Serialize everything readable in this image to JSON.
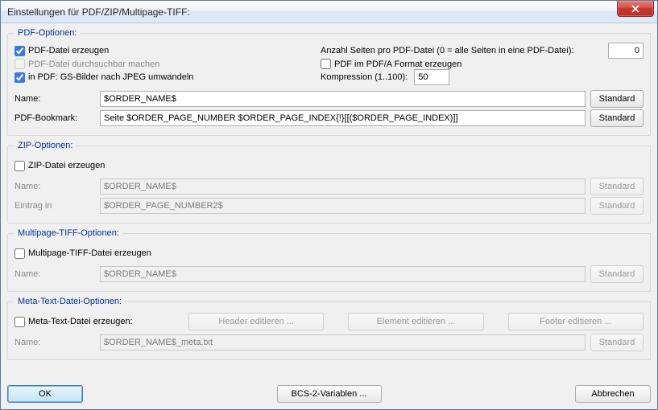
{
  "window": {
    "title": "Einstellungen für PDF/ZIP/Multipage-TIFF:"
  },
  "pdf": {
    "legend": "PDF-Optionen:",
    "create_label": "PDF-Datei erzeugen",
    "create_checked": true,
    "searchable_label": "PDF-Datei durchsuchbar machen",
    "searchable_checked": false,
    "jpeg_label": "in PDF: GS-Bilder nach JPEG umwandeln",
    "jpeg_checked": true,
    "pages_label": "Anzahl Seiten pro PDF-Datei (0 = alle Seiten in eine PDF-Datei):",
    "pages_value": "0",
    "pdfa_label": "PDF im PDF/A Format erzeugen",
    "pdfa_checked": false,
    "compression_label": "Kompression (1..100):",
    "compression_value": "50",
    "name_label": "Name:",
    "name_value": "$ORDER_NAME$",
    "bookmark_label": "PDF-Bookmark:",
    "bookmark_value": "Seite $ORDER_PAGE_NUMBER $ORDER_PAGE_INDEX{!}[[($ORDER_PAGE_INDEX)]]",
    "standard_label": "Standard"
  },
  "zip": {
    "legend": "ZIP-Optionen:",
    "create_label": "ZIP-Datei erzeugen",
    "create_checked": false,
    "name_label": "Name:",
    "name_value": "$ORDER_NAME$",
    "entry_label": "Eintrag in",
    "entry_value": "$ORDER_PAGE_NUMBER2$",
    "standard_label": "Standard"
  },
  "tiff": {
    "legend": "Multipage-TIFF-Optionen:",
    "create_label": "Multipage-TIFF-Datei erzeugen",
    "create_checked": false,
    "name_label": "Name:",
    "name_value": "$ORDER_NAME$",
    "standard_label": "Standard"
  },
  "meta": {
    "legend": "Meta-Text-Datei-Optionen:",
    "create_label": "Meta-Text-Datei erzeugen:",
    "create_checked": false,
    "header_btn": "Header editieren ...",
    "element_btn": "Element editieren ...",
    "footer_btn": "Footer editieren ...",
    "name_label": "Name:",
    "name_value": "$ORDER_NAME$_meta.txt",
    "standard_label": "Standard"
  },
  "buttons": {
    "ok": "OK",
    "bcs": "BCS-2-Variablen ...",
    "cancel": "Abbrechen"
  }
}
